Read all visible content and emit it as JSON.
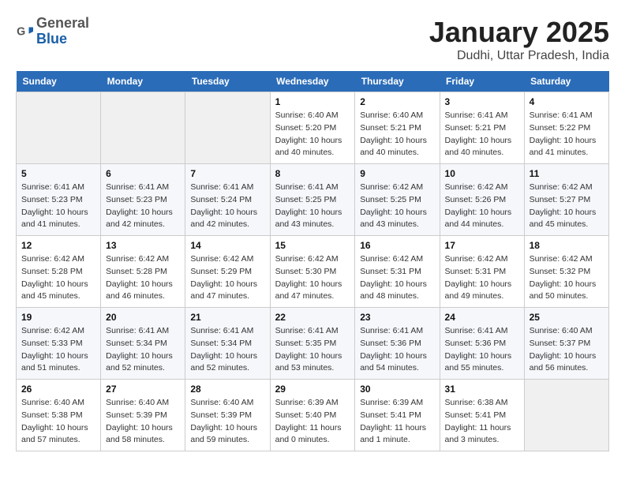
{
  "header": {
    "logo_general": "General",
    "logo_blue": "Blue",
    "title": "January 2025",
    "subtitle": "Dudhi, Uttar Pradesh, India"
  },
  "days_of_week": [
    "Sunday",
    "Monday",
    "Tuesday",
    "Wednesday",
    "Thursday",
    "Friday",
    "Saturday"
  ],
  "weeks": [
    [
      {
        "num": "",
        "info": ""
      },
      {
        "num": "",
        "info": ""
      },
      {
        "num": "",
        "info": ""
      },
      {
        "num": "1",
        "info": "Sunrise: 6:40 AM\nSunset: 5:20 PM\nDaylight: 10 hours\nand 40 minutes."
      },
      {
        "num": "2",
        "info": "Sunrise: 6:40 AM\nSunset: 5:21 PM\nDaylight: 10 hours\nand 40 minutes."
      },
      {
        "num": "3",
        "info": "Sunrise: 6:41 AM\nSunset: 5:21 PM\nDaylight: 10 hours\nand 40 minutes."
      },
      {
        "num": "4",
        "info": "Sunrise: 6:41 AM\nSunset: 5:22 PM\nDaylight: 10 hours\nand 41 minutes."
      }
    ],
    [
      {
        "num": "5",
        "info": "Sunrise: 6:41 AM\nSunset: 5:23 PM\nDaylight: 10 hours\nand 41 minutes."
      },
      {
        "num": "6",
        "info": "Sunrise: 6:41 AM\nSunset: 5:23 PM\nDaylight: 10 hours\nand 42 minutes."
      },
      {
        "num": "7",
        "info": "Sunrise: 6:41 AM\nSunset: 5:24 PM\nDaylight: 10 hours\nand 42 minutes."
      },
      {
        "num": "8",
        "info": "Sunrise: 6:41 AM\nSunset: 5:25 PM\nDaylight: 10 hours\nand 43 minutes."
      },
      {
        "num": "9",
        "info": "Sunrise: 6:42 AM\nSunset: 5:25 PM\nDaylight: 10 hours\nand 43 minutes."
      },
      {
        "num": "10",
        "info": "Sunrise: 6:42 AM\nSunset: 5:26 PM\nDaylight: 10 hours\nand 44 minutes."
      },
      {
        "num": "11",
        "info": "Sunrise: 6:42 AM\nSunset: 5:27 PM\nDaylight: 10 hours\nand 45 minutes."
      }
    ],
    [
      {
        "num": "12",
        "info": "Sunrise: 6:42 AM\nSunset: 5:28 PM\nDaylight: 10 hours\nand 45 minutes."
      },
      {
        "num": "13",
        "info": "Sunrise: 6:42 AM\nSunset: 5:28 PM\nDaylight: 10 hours\nand 46 minutes."
      },
      {
        "num": "14",
        "info": "Sunrise: 6:42 AM\nSunset: 5:29 PM\nDaylight: 10 hours\nand 47 minutes."
      },
      {
        "num": "15",
        "info": "Sunrise: 6:42 AM\nSunset: 5:30 PM\nDaylight: 10 hours\nand 47 minutes."
      },
      {
        "num": "16",
        "info": "Sunrise: 6:42 AM\nSunset: 5:31 PM\nDaylight: 10 hours\nand 48 minutes."
      },
      {
        "num": "17",
        "info": "Sunrise: 6:42 AM\nSunset: 5:31 PM\nDaylight: 10 hours\nand 49 minutes."
      },
      {
        "num": "18",
        "info": "Sunrise: 6:42 AM\nSunset: 5:32 PM\nDaylight: 10 hours\nand 50 minutes."
      }
    ],
    [
      {
        "num": "19",
        "info": "Sunrise: 6:42 AM\nSunset: 5:33 PM\nDaylight: 10 hours\nand 51 minutes."
      },
      {
        "num": "20",
        "info": "Sunrise: 6:41 AM\nSunset: 5:34 PM\nDaylight: 10 hours\nand 52 minutes."
      },
      {
        "num": "21",
        "info": "Sunrise: 6:41 AM\nSunset: 5:34 PM\nDaylight: 10 hours\nand 52 minutes."
      },
      {
        "num": "22",
        "info": "Sunrise: 6:41 AM\nSunset: 5:35 PM\nDaylight: 10 hours\nand 53 minutes."
      },
      {
        "num": "23",
        "info": "Sunrise: 6:41 AM\nSunset: 5:36 PM\nDaylight: 10 hours\nand 54 minutes."
      },
      {
        "num": "24",
        "info": "Sunrise: 6:41 AM\nSunset: 5:36 PM\nDaylight: 10 hours\nand 55 minutes."
      },
      {
        "num": "25",
        "info": "Sunrise: 6:40 AM\nSunset: 5:37 PM\nDaylight: 10 hours\nand 56 minutes."
      }
    ],
    [
      {
        "num": "26",
        "info": "Sunrise: 6:40 AM\nSunset: 5:38 PM\nDaylight: 10 hours\nand 57 minutes."
      },
      {
        "num": "27",
        "info": "Sunrise: 6:40 AM\nSunset: 5:39 PM\nDaylight: 10 hours\nand 58 minutes."
      },
      {
        "num": "28",
        "info": "Sunrise: 6:40 AM\nSunset: 5:39 PM\nDaylight: 10 hours\nand 59 minutes."
      },
      {
        "num": "29",
        "info": "Sunrise: 6:39 AM\nSunset: 5:40 PM\nDaylight: 11 hours\nand 0 minutes."
      },
      {
        "num": "30",
        "info": "Sunrise: 6:39 AM\nSunset: 5:41 PM\nDaylight: 11 hours\nand 1 minute."
      },
      {
        "num": "31",
        "info": "Sunrise: 6:38 AM\nSunset: 5:41 PM\nDaylight: 11 hours\nand 3 minutes."
      },
      {
        "num": "",
        "info": ""
      }
    ]
  ]
}
